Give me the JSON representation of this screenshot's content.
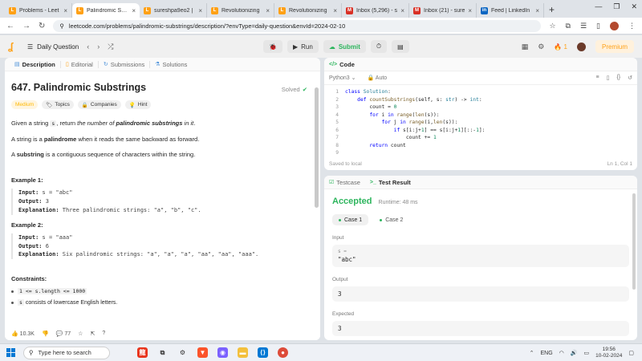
{
  "browser": {
    "tabs": [
      {
        "title": "Problems - Leet",
        "icon": "leetcode-favicon",
        "color": "#ffa116",
        "active": false
      },
      {
        "title": "Palindromic Subs",
        "icon": "leetcode-favicon",
        "color": "#ffa116",
        "active": true
      },
      {
        "title": "sureshpa9eo2 |",
        "icon": "leetcode-favicon",
        "color": "#ffa116",
        "active": false
      },
      {
        "title": "Revolutionizing",
        "icon": "leetcode-favicon",
        "color": "#ffa116",
        "active": false
      },
      {
        "title": "Revolutionizing",
        "icon": "leetcode-favicon",
        "color": "#ffa116",
        "active": false
      },
      {
        "title": "Inbox (5,296) - s",
        "icon": "gmail-favicon",
        "color": "#d93025",
        "active": false
      },
      {
        "title": "Inbox (21) - sure",
        "icon": "gmail-favicon",
        "color": "#d93025",
        "active": false
      },
      {
        "title": "Feed | LinkedIn",
        "icon": "linkedin-favicon",
        "color": "#0a66c2",
        "active": false
      }
    ],
    "url": "leetcode.com/problems/palindromic-substrings/description/?envType=daily-question&envId=2024-02-10"
  },
  "nav": {
    "daily_label": "Daily Question",
    "run_label": "Run",
    "submit_label": "Submit",
    "streak": "1",
    "premium_label": "Premium"
  },
  "left": {
    "tabs": [
      "Description",
      "Editorial",
      "Submissions",
      "Solutions"
    ],
    "title": "647. Palindromic Substrings",
    "solved_label": "Solved",
    "tags": [
      "Medium",
      "Topics",
      "Companies",
      "Hint"
    ],
    "desc1_a": "Given a string ",
    "desc1_code": "s",
    "desc1_b": ", return ",
    "desc1_em1": "the number of ",
    "desc1_strong": "palindromic substrings",
    "desc1_em2": " in it",
    "desc1_end": ".",
    "desc2_a": "A string is a ",
    "desc2_strong": "palindrome",
    "desc2_b": " when it reads the same backward as forward.",
    "desc3_a": "A ",
    "desc3_strong": "substring",
    "desc3_b": " is a contiguous sequence of characters within the string.",
    "ex1_title": "Example 1:",
    "ex1_input_k": "Input:",
    "ex1_input_v": " s = \"abc\"",
    "ex1_output_k": "Output:",
    "ex1_output_v": " 3",
    "ex1_expl_k": "Explanation:",
    "ex1_expl_v": " Three palindromic strings: \"a\", \"b\", \"c\".",
    "ex2_title": "Example 2:",
    "ex2_input_k": "Input:",
    "ex2_input_v": " s = \"aaa\"",
    "ex2_output_k": "Output:",
    "ex2_output_v": " 6",
    "ex2_expl_k": "Explanation:",
    "ex2_expl_v": " Six palindromic strings: \"a\", \"a\", \"a\", \"aa\", \"aa\", \"aaa\".",
    "constraints_title": "Constraints:",
    "c1_code": "1 <= s.length <= 1000",
    "c2_code": "s",
    "c2_text": " consists of lowercase English letters.",
    "likes": "10.3K",
    "comments": "77"
  },
  "code": {
    "tab_label": "Code",
    "language": "Python3",
    "auto_label": "Auto",
    "saved_label": "Saved to local",
    "cursor": "Ln 1, Col 1"
  },
  "result": {
    "tabs": [
      "Testcase",
      "Test Result"
    ],
    "status": "Accepted",
    "runtime": "Runtime: 48 ms",
    "cases": [
      "Case 1",
      "Case 2"
    ],
    "input_label": "Input",
    "input_var": "s =",
    "input_value": "\"abc\"",
    "output_label": "Output",
    "output_value": "3",
    "expected_label": "Expected",
    "expected_value": "3"
  },
  "taskbar": {
    "search_placeholder": "Type here to search",
    "lang": "ENG",
    "time": "19:56",
    "date": "10-02-2024"
  }
}
